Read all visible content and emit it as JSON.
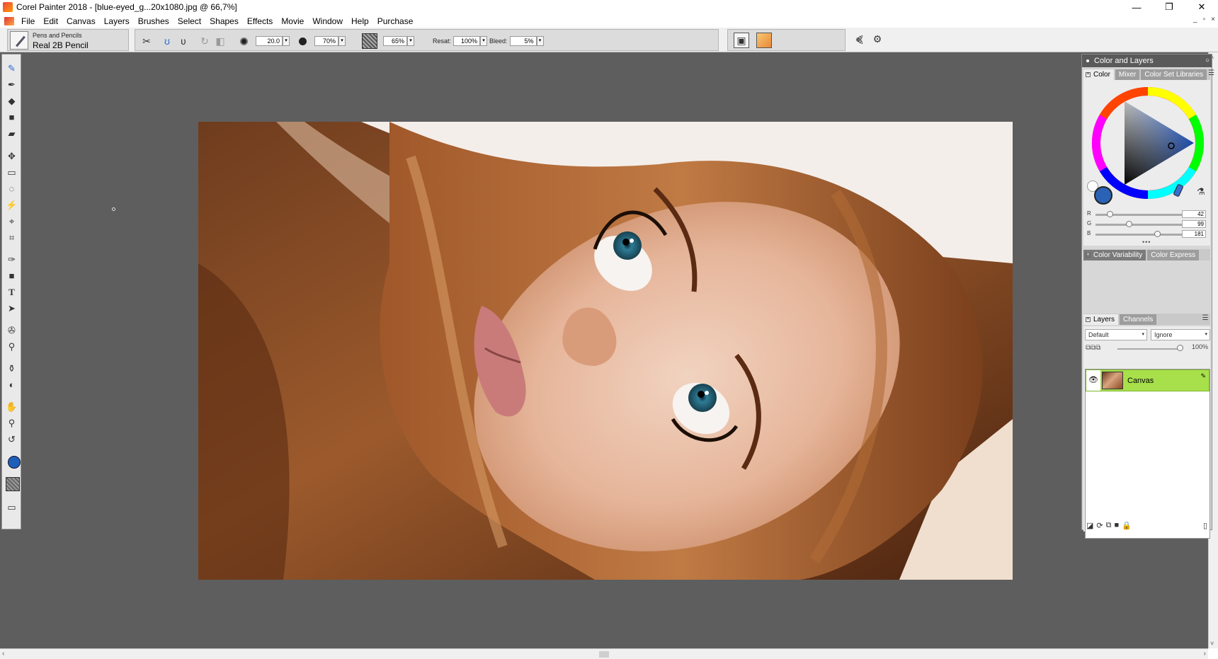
{
  "window": {
    "title": "Corel Painter 2018 - [blue-eyed_g...20x1080.jpg @ 66,7%]",
    "minimize_glyph": "—",
    "restore_glyph": "❐",
    "close_glyph": "✕"
  },
  "menu": {
    "items": [
      "File",
      "Edit",
      "Canvas",
      "Layers",
      "Brushes",
      "Select",
      "Shapes",
      "Effects",
      "Movie",
      "Window",
      "Help",
      "Purchase"
    ]
  },
  "mdi": {
    "minimize": "_",
    "restore": "▫",
    "close": "×"
  },
  "property_bar": {
    "brush_category": "Pens and Pencils",
    "brush_variant": "Real 2B Pencil",
    "size": "20.0",
    "opacity": "70%",
    "grain": "65%",
    "resat_label": "Resat:",
    "resat": "100%",
    "bleed_label": "Bleed:",
    "bleed": "5%",
    "dropdown_glyph": "▾"
  },
  "toolbox": {
    "icons": [
      "brush-icon",
      "dropper-icon",
      "paint-bucket-icon",
      "eraser-icon",
      "ruler-icon",
      "transform-icon",
      "rect-select-icon",
      "lasso-icon",
      "magic-wand-icon",
      "layer-adjuster-icon",
      "crop-icon",
      "pen-icon",
      "shape-icon",
      "text-icon",
      "shape-selection-icon",
      "cloner-icon",
      "rubber-stamp-icon",
      "blender-icon",
      "dodge-icon",
      "grabber-icon",
      "magnifier-icon",
      "rotate-page-icon"
    ],
    "main_color": "#1f5fb8"
  },
  "panel": {
    "title": "Color and Layers",
    "close_glyph": "○",
    "color_tabs": [
      "Color",
      "Mixer",
      "Color Set Libraries"
    ],
    "rgb": {
      "r_label": "R",
      "r": "42",
      "g_label": "G",
      "g": "99",
      "b_label": "B",
      "b": "181"
    },
    "variability_tabs": [
      "Color Variability",
      "Color Express"
    ],
    "layer_tabs": [
      "Layers",
      "Channels"
    ],
    "composite_method": "Default",
    "preserve": "Ignore",
    "layer_opacity": "100%",
    "layers": [
      {
        "name": "Canvas"
      }
    ],
    "selected_layer_color": "#a8e04c"
  },
  "scroll": {
    "left": "‹",
    "right": "›",
    "up": "˄",
    "down": "˅"
  }
}
